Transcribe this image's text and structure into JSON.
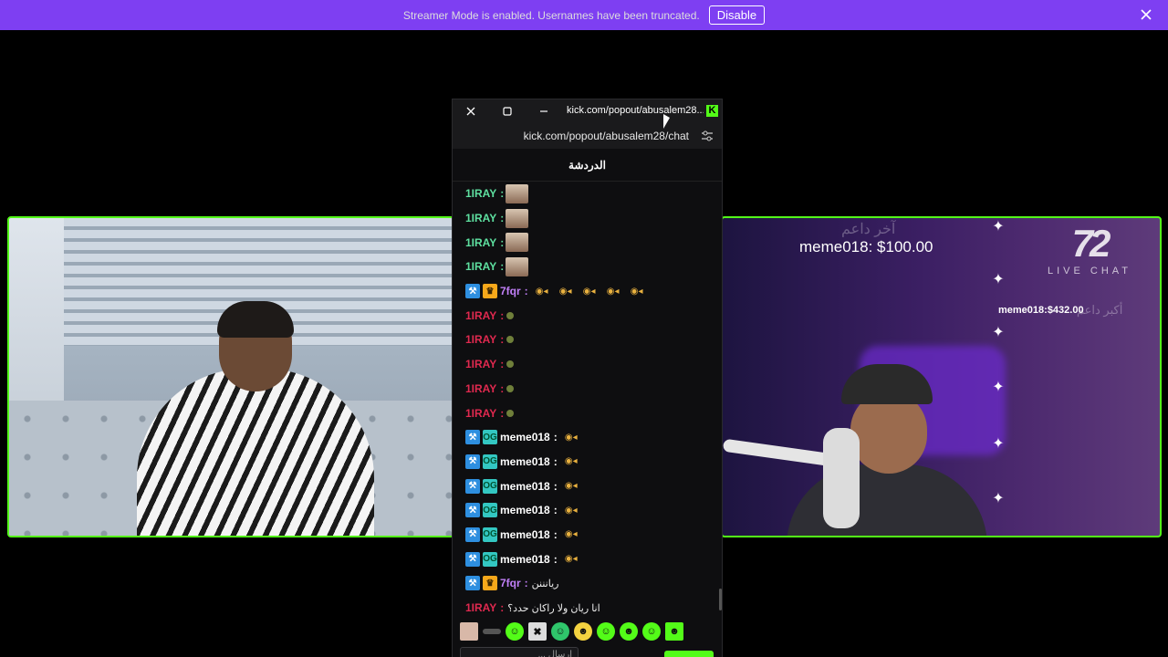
{
  "banner": {
    "message": "Streamer Mode is enabled. Usernames have been truncated.",
    "disable_label": "Disable",
    "color": "#7e3ff2"
  },
  "chat_window": {
    "title": "kick.com/popout/abusalem28...",
    "url": "kick.com/popout/abusalem28/chat",
    "header": "الدردشة",
    "input_placeholder": "إرسال ...",
    "accent": "#53fc18"
  },
  "messages": [
    {
      "user": "1IRAY",
      "color": "#5ee0a0",
      "badges": [],
      "emote": "face"
    },
    {
      "user": "1IRAY",
      "color": "#5ee0a0",
      "badges": [],
      "emote": "face"
    },
    {
      "user": "1IRAY",
      "color": "#5ee0a0",
      "badges": [],
      "emote": "face"
    },
    {
      "user": "1IRAY",
      "color": "#5ee0a0",
      "badges": [],
      "emote": "face"
    },
    {
      "user": "7fqr",
      "color": "#c17ff8",
      "badges": [
        "mod",
        "crown"
      ],
      "emote": "bees"
    },
    {
      "user": "1IRAY",
      "color": "#e0294f",
      "badges": [],
      "emote": "dot"
    },
    {
      "user": "1IRAY",
      "color": "#e0294f",
      "badges": [],
      "emote": "dot"
    },
    {
      "user": "1IRAY",
      "color": "#e0294f",
      "badges": [],
      "emote": "dot"
    },
    {
      "user": "1IRAY",
      "color": "#e0294f",
      "badges": [],
      "emote": "dot"
    },
    {
      "user": "1IRAY",
      "color": "#e0294f",
      "badges": [],
      "emote": "dot"
    },
    {
      "user": "meme018",
      "color": "#ffffff",
      "badges": [
        "mod",
        "og"
      ],
      "emote": "bee"
    },
    {
      "user": "meme018",
      "color": "#ffffff",
      "badges": [
        "mod",
        "og"
      ],
      "emote": "bee"
    },
    {
      "user": "meme018",
      "color": "#ffffff",
      "badges": [
        "mod",
        "og"
      ],
      "emote": "bee"
    },
    {
      "user": "meme018",
      "color": "#ffffff",
      "badges": [
        "mod",
        "og"
      ],
      "emote": "bee"
    },
    {
      "user": "meme018",
      "color": "#ffffff",
      "badges": [
        "mod",
        "og"
      ],
      "emote": "bee"
    },
    {
      "user": "meme018",
      "color": "#ffffff",
      "badges": [
        "mod",
        "og"
      ],
      "emote": "bee"
    },
    {
      "user": "7fqr",
      "color": "#c17ff8",
      "badges": [
        "mod",
        "crown"
      ],
      "text": "ريانننن"
    },
    {
      "user": "1IRAY",
      "color": "#e0294f",
      "badges": [],
      "text": "انا ريان ولا راكان حدد؟"
    }
  ],
  "overlay": {
    "top_donation": "meme018: $100.00",
    "top_donation_faded": "آخر داعم",
    "side_donation": "meme018:$432.00",
    "side_donation_faded": "أكبر داعم",
    "logo_mark": "72",
    "logo_label": "LIVE CHAT"
  }
}
